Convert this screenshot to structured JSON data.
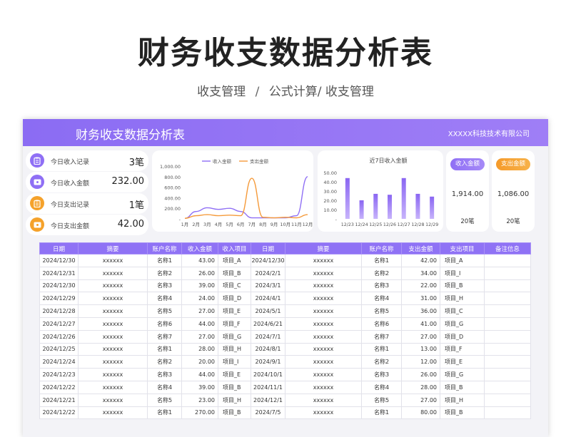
{
  "hero": {
    "title": "财务收支数据分析表",
    "subtitle_parts": [
      "收支管理",
      "/",
      "公式计算/",
      "收支管理"
    ]
  },
  "sheet": {
    "title": "财务收支数据分析表",
    "company": "XXXXX科技技术有限公司"
  },
  "stats": [
    {
      "label": "今日收入记录",
      "value": "3笔",
      "icon": "clipboard-icon",
      "color": "#8f6ff5"
    },
    {
      "label": "今日收入金额",
      "value": "232.00",
      "icon": "wallet-icon",
      "color": "#8f6ff5"
    },
    {
      "label": "今日支出记录",
      "value": "1笔",
      "icon": "clipboard-icon",
      "color": "#f5a22b"
    },
    {
      "label": "今日支出金额",
      "value": "42.00",
      "icon": "wallet-icon",
      "color": "#f5a22b"
    }
  ],
  "cards": {
    "income": {
      "label": "收入金额",
      "amount": "1,914.00",
      "count": "20笔",
      "color": "#8f6ff5"
    },
    "expense": {
      "label": "支出金额",
      "amount": "1,086.00",
      "count": "20笔",
      "color": "#f5a22b"
    }
  },
  "chart_data": [
    {
      "type": "line",
      "x": [
        "1月",
        "2月",
        "3月",
        "4月",
        "5月",
        "6月",
        "7月",
        "8月",
        "9月",
        "10月",
        "11月",
        "12月"
      ],
      "series": [
        {
          "name": "收入金额",
          "color": "#8f6ff5",
          "values": [
            10,
            140,
            210,
            180,
            200,
            140,
            20,
            20,
            20,
            20,
            60,
            800
          ]
        },
        {
          "name": "支出金额",
          "color": "#f59a3a",
          "values": [
            10,
            60,
            80,
            60,
            70,
            60,
            770,
            30,
            20,
            30,
            20,
            80
          ]
        }
      ],
      "yticks": [
        "1,000.00",
        "800.00",
        "600.00",
        "400.00",
        "200.00",
        "-"
      ],
      "ylim": [
        0,
        1000
      ],
      "legend": "top"
    },
    {
      "type": "bar",
      "title": "近7日收入金额",
      "categories": [
        "12/23",
        "12/24",
        "12/25",
        "12/26",
        "12/27",
        "12/28",
        "12/29"
      ],
      "values": [
        44,
        20,
        27,
        26,
        44,
        27,
        24
      ],
      "yticks": [
        "50.00",
        "40.00",
        "30.00",
        "20.00",
        "10.00",
        "-"
      ],
      "ylim": [
        0,
        50
      ],
      "color": "#8f6ff5"
    }
  ],
  "table": {
    "headers": [
      "日期",
      "摘要",
      "账户名称",
      "收入金额",
      "收入项目",
      "日期",
      "摘要",
      "账户名称",
      "支出金额",
      "支出项目",
      "备注信息"
    ],
    "rows": [
      [
        "2024/12/30",
        "xxxxxx",
        "名称1",
        "43.00",
        "项目_A",
        "2024/12/30",
        "xxxxxx",
        "名称1",
        "42.00",
        "项目_A",
        ""
      ],
      [
        "2024/12/31",
        "xxxxxx",
        "名称2",
        "26.00",
        "项目_B",
        "2024/2/1",
        "xxxxxx",
        "名称2",
        "34.00",
        "项目_I",
        ""
      ],
      [
        "2024/12/30",
        "xxxxxx",
        "名称3",
        "39.00",
        "项目_C",
        "2024/3/1",
        "xxxxxx",
        "名称3",
        "22.00",
        "项目_B",
        ""
      ],
      [
        "2024/12/29",
        "xxxxxx",
        "名称4",
        "24.00",
        "项目_D",
        "2024/4/1",
        "xxxxxx",
        "名称4",
        "31.00",
        "项目_H",
        ""
      ],
      [
        "2024/12/28",
        "xxxxxx",
        "名称5",
        "27.00",
        "项目_E",
        "2024/5/1",
        "xxxxxx",
        "名称5",
        "36.00",
        "项目_C",
        ""
      ],
      [
        "2024/12/27",
        "xxxxxx",
        "名称6",
        "44.00",
        "项目_F",
        "2024/6/21",
        "xxxxxx",
        "名称6",
        "41.00",
        "项目_G",
        ""
      ],
      [
        "2024/12/26",
        "xxxxxx",
        "名称7",
        "27.00",
        "项目_G",
        "2024/7/1",
        "xxxxxx",
        "名称7",
        "27.00",
        "项目_D",
        ""
      ],
      [
        "2024/12/25",
        "xxxxxx",
        "名称1",
        "28.00",
        "项目_H",
        "2024/8/1",
        "xxxxxx",
        "名称1",
        "13.00",
        "项目_F",
        ""
      ],
      [
        "2024/12/24",
        "xxxxxx",
        "名称2",
        "20.00",
        "项目_I",
        "2024/9/1",
        "xxxxxx",
        "名称2",
        "12.00",
        "项目_E",
        ""
      ],
      [
        "2024/12/23",
        "xxxxxx",
        "名称3",
        "44.00",
        "项目_E",
        "2024/10/1",
        "xxxxxx",
        "名称3",
        "26.00",
        "项目_G",
        ""
      ],
      [
        "2024/12/22",
        "xxxxxx",
        "名称4",
        "39.00",
        "项目_B",
        "2024/11/1",
        "xxxxxx",
        "名称4",
        "28.00",
        "项目_B",
        ""
      ],
      [
        "2024/12/21",
        "xxxxxx",
        "名称5",
        "23.00",
        "项目_H",
        "2024/12/1",
        "xxxxxx",
        "名称5",
        "27.00",
        "项目_H",
        ""
      ],
      [
        "2024/12/22",
        "xxxxxx",
        "名称1",
        "270.00",
        "项目_B",
        "2024/7/5",
        "xxxxxx",
        "名称1",
        "80.00",
        "项目_B",
        ""
      ]
    ]
  }
}
